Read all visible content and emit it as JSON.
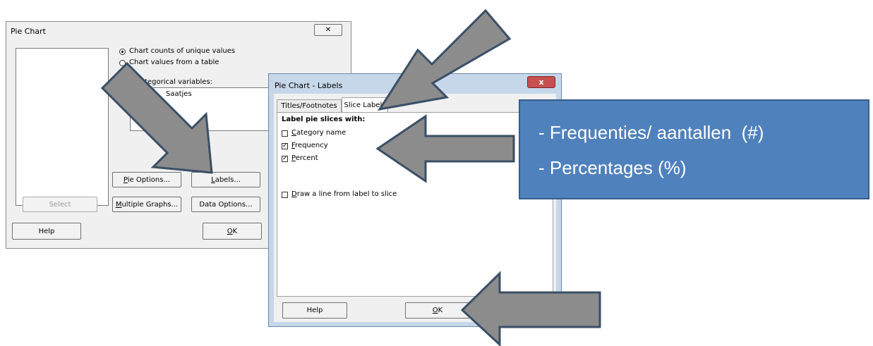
{
  "pie_chart_dialog": {
    "title": "Pie Chart",
    "close_glyph": "✕",
    "radio_counts": "Chart counts of unique values",
    "radio_table": "Chart values from a table",
    "categorical_label": "Categorical variables:",
    "variable_value": "Saatjes",
    "pie_options_button": "Pie Options...",
    "labels_button": "Labels...",
    "select_button": "Select",
    "multiple_graphs_button": "Multiple Graphs...",
    "data_options_button": "Data Options...",
    "help_button": "Help",
    "ok_button": "OK"
  },
  "labels_dialog": {
    "title": "Pie Chart - Labels",
    "close_glyph": "x",
    "tabs": [
      "Titles/Footnotes",
      "Slice Labels"
    ],
    "group_label": "Label pie slices with:",
    "options": [
      {
        "label": "Category name",
        "checked": false
      },
      {
        "label": "Frequency",
        "checked": true
      },
      {
        "label": "Percent",
        "checked": true
      }
    ],
    "draw_line_label": "Draw a line from label to slice",
    "draw_line_checked": false,
    "help_button": "Help",
    "ok_button": "OK"
  },
  "callout": {
    "line1": "- Frequenties/ aantallen  (#)",
    "line2": "- Percentages (%)",
    "bg_color": "#4f81bd"
  },
  "arrow_color": "#8c8c8c",
  "check_glyph": "✓"
}
